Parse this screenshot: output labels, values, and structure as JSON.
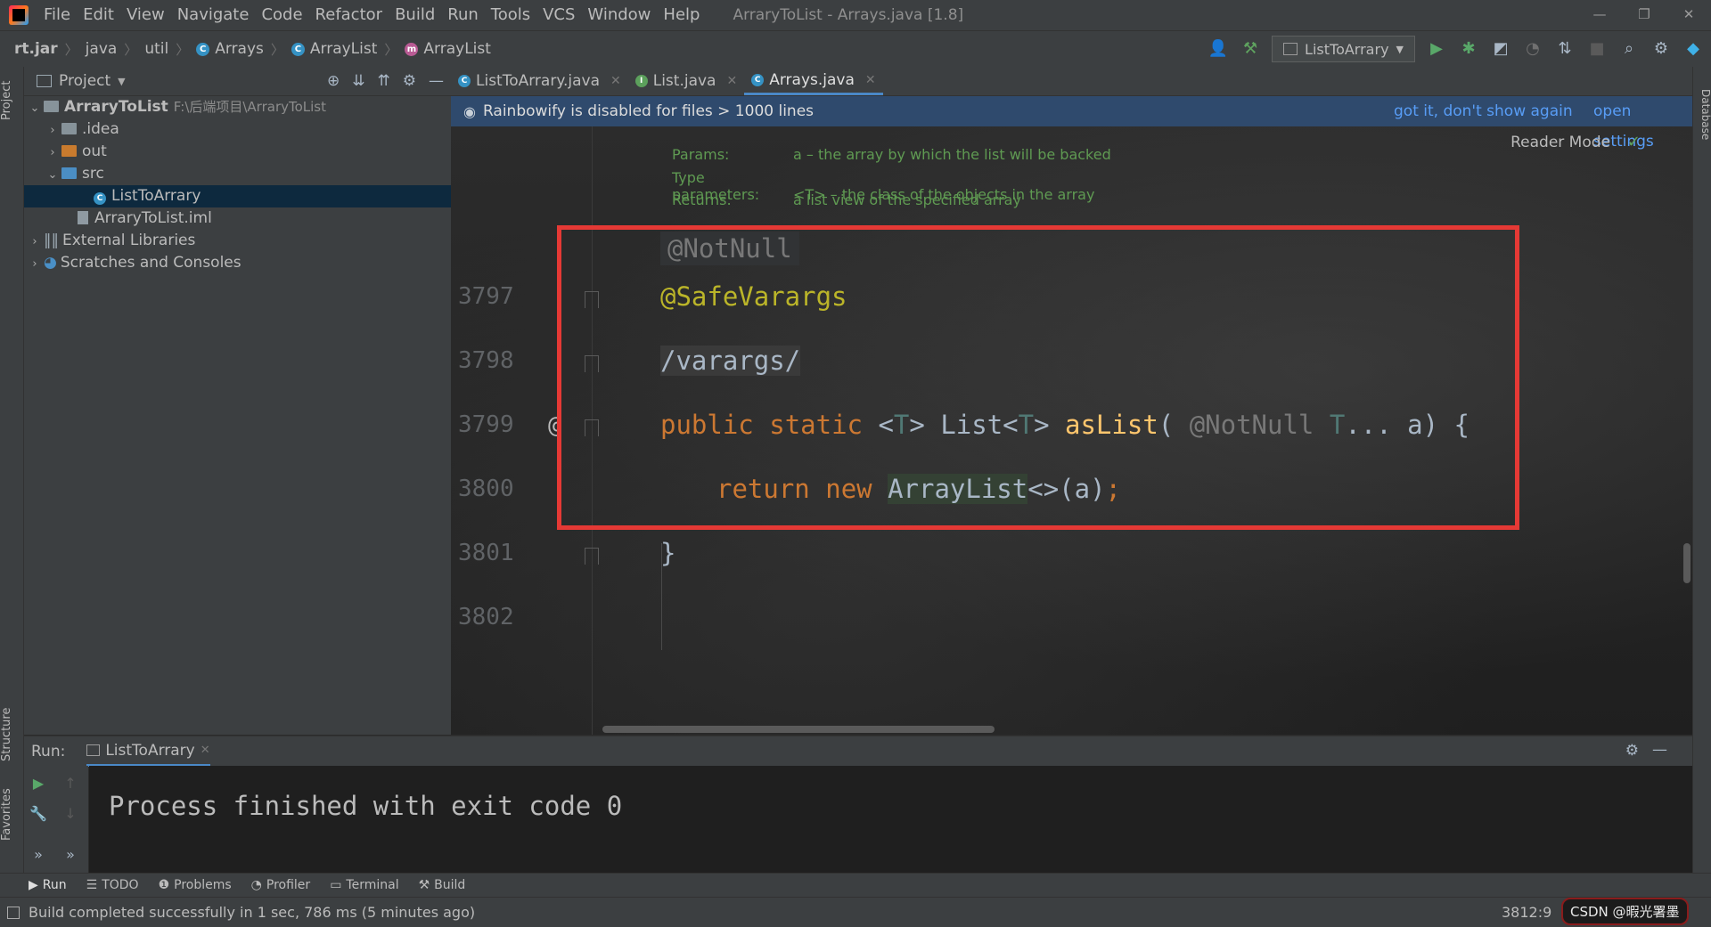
{
  "window": {
    "title": "ArraryToList - Arrays.java [1.8]",
    "menu": [
      "File",
      "Edit",
      "View",
      "Navigate",
      "Code",
      "Refactor",
      "Build",
      "Run",
      "Tools",
      "VCS",
      "Window",
      "Help"
    ],
    "controls": [
      "—",
      "❐",
      "✕"
    ]
  },
  "breadcrumb": {
    "items": [
      {
        "label": "rt.jar",
        "icon": ""
      },
      {
        "label": "java",
        "icon": ""
      },
      {
        "label": "util",
        "icon": ""
      },
      {
        "label": "Arrays",
        "icon": "C"
      },
      {
        "label": "ArrayList",
        "icon": "C"
      },
      {
        "label": "ArrayList",
        "icon": "m"
      }
    ],
    "run_config": "ListToArrary"
  },
  "sidebar": {
    "left_tabs": [
      "Project",
      "Structure",
      "Favorites"
    ],
    "right_tabs": [
      "Database"
    ]
  },
  "project": {
    "title": "Project",
    "tree": [
      {
        "label": "ArraryToList",
        "hint": "F:\\后端项目\\ArraryToList",
        "arrow": "⌄",
        "icon": "gray",
        "level": 0
      },
      {
        "label": ".idea",
        "arrow": "›",
        "icon": "gray",
        "level": 1
      },
      {
        "label": "out",
        "arrow": "›",
        "icon": "orange",
        "level": 1
      },
      {
        "label": "src",
        "arrow": "⌄",
        "icon": "blue",
        "level": 1
      },
      {
        "label": "ListToArrary",
        "arrow": "",
        "icon": "class",
        "level": 3,
        "selected": true
      },
      {
        "label": "ArraryToList.iml",
        "arrow": "",
        "icon": "file",
        "level": 2
      },
      {
        "label": "External Libraries",
        "arrow": "›",
        "icon": "lib",
        "level": 0
      },
      {
        "label": "Scratches and Consoles",
        "arrow": "›",
        "icon": "scratch",
        "level": 0
      }
    ]
  },
  "editor": {
    "tabs": [
      {
        "label": "ListToArrary.java",
        "icon": "C",
        "active": false
      },
      {
        "label": "List.java",
        "icon": "I",
        "active": false
      },
      {
        "label": "Arrays.java",
        "icon": "C",
        "active": true
      }
    ],
    "banner": {
      "text": "Rainbowify is disabled for files > 1000 lines",
      "link1": "got it, don't show again",
      "link2": "open settings"
    },
    "reader_mode": "Reader Mode",
    "doc": [
      {
        "label": "Params:",
        "text": "a – the array by which the list will be backed"
      },
      {
        "label": "Type parameters:",
        "text": "<T> – the class of the objects in the array"
      },
      {
        "label": "Returns:",
        "text": "a list view of the specified array"
      }
    ],
    "notnull_hint": "@NotNull",
    "line_numbers": [
      "3797",
      "3798",
      "3799",
      "3800",
      "3801",
      "3802"
    ],
    "gutter_at": "@",
    "code": {
      "l1_annotation": "@SafeVarargs",
      "l2_comment": "/varargs/",
      "l3_public": "public",
      "l3_static": "static",
      "l3_lt": " <",
      "l3_T1": "T",
      "l3_gt": "> ",
      "l3_list": "List<",
      "l3_T2": "T",
      "l3_gt2": "> ",
      "l3_method": "asList",
      "l3_paren": "( ",
      "l3_notnull": "@NotNull",
      "l3_T3": " T",
      "l3_rest": "... a) {",
      "l4_return": "return",
      "l4_new": "new",
      "l4_class": "ArrayList",
      "l4_args": "<>(a)",
      "l4_semi": ";",
      "l5_brace": "}"
    }
  },
  "run_panel": {
    "label": "Run:",
    "tab": "ListToArrary",
    "output": "Process finished with exit code 0"
  },
  "bottom_tabs": [
    {
      "label": "Run",
      "icon": "▶"
    },
    {
      "label": "TODO",
      "icon": "☰"
    },
    {
      "label": "Problems",
      "icon": "❶"
    },
    {
      "label": "Profiler",
      "icon": "◔"
    },
    {
      "label": "Terminal",
      "icon": "▭"
    },
    {
      "label": "Build",
      "icon": "⚒"
    }
  ],
  "status": {
    "text": "Build completed successfully in 1 sec, 786 ms (5 minutes ago)",
    "cursor": "3812:9",
    "watermark": "CSDN @暇光署墨"
  }
}
